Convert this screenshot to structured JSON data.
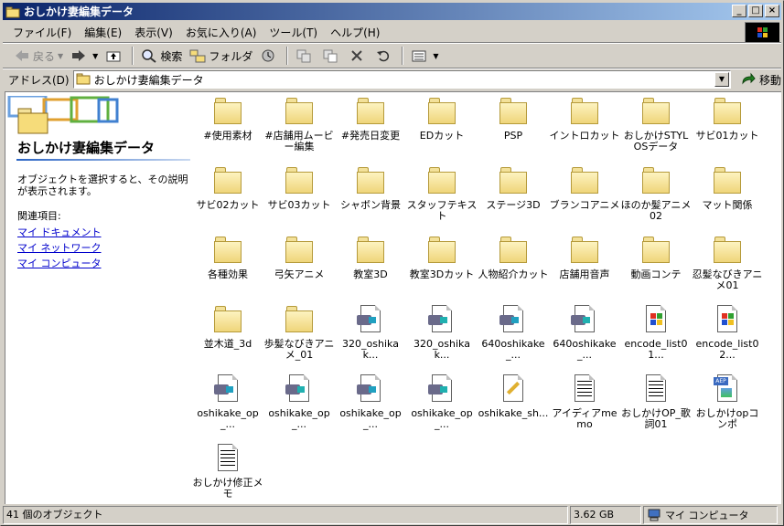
{
  "window": {
    "title": "おしかけ妻編集データ",
    "controls": {
      "minimize": "_",
      "maximize": "□",
      "close": "×"
    }
  },
  "menu": [
    "ファイル(F)",
    "編集(E)",
    "表示(V)",
    "お気に入り(A)",
    "ツール(T)",
    "ヘルプ(H)"
  ],
  "toolbar": {
    "back": "戻る",
    "search": "検索",
    "folders": "フォルダ"
  },
  "address": {
    "label": "アドレス(D)",
    "value": "おしかけ妻編集データ",
    "go": "移動"
  },
  "left_panel": {
    "title": "おしかけ妻編集データ",
    "description": "オブジェクトを選択すると、その説明が表示されます。",
    "related_heading": "関連項目:",
    "links": [
      "マイ ドキュメント",
      "マイ ネットワーク",
      "マイ コンピュータ"
    ]
  },
  "items": [
    {
      "label": "#使用素材",
      "type": "folder"
    },
    {
      "label": "#店舗用ムービー編集",
      "type": "folder"
    },
    {
      "label": "#発売日変更",
      "type": "folder"
    },
    {
      "label": "EDカット",
      "type": "folder"
    },
    {
      "label": "PSP",
      "type": "folder"
    },
    {
      "label": "イントロカット",
      "type": "folder"
    },
    {
      "label": "おしかけSTYLOSデータ",
      "type": "folder"
    },
    {
      "label": "サビ01カット",
      "type": "folder"
    },
    {
      "label": "サビ02カット",
      "type": "folder"
    },
    {
      "label": "サビ03カット",
      "type": "folder"
    },
    {
      "label": "シャボン背景",
      "type": "folder"
    },
    {
      "label": "スタッフテキスト",
      "type": "folder"
    },
    {
      "label": "ステージ3D",
      "type": "folder"
    },
    {
      "label": "ブランコアニメ",
      "type": "folder"
    },
    {
      "label": "ほのか髪アニメ02",
      "type": "folder"
    },
    {
      "label": "マット関係",
      "type": "folder"
    },
    {
      "label": "各種効果",
      "type": "folder"
    },
    {
      "label": "弓矢アニメ",
      "type": "folder"
    },
    {
      "label": "教室3D",
      "type": "folder"
    },
    {
      "label": "教室3Dカット",
      "type": "folder"
    },
    {
      "label": "人物紹介カット",
      "type": "folder"
    },
    {
      "label": "店舗用音声",
      "type": "folder"
    },
    {
      "label": "動画コンテ",
      "type": "folder"
    },
    {
      "label": "忍髪なびきアニメ01",
      "type": "folder"
    },
    {
      "label": "並木道_3d",
      "type": "folder"
    },
    {
      "label": "歩髪なびきアニメ_01",
      "type": "folder"
    },
    {
      "label": "320_oshikak...",
      "type": "video"
    },
    {
      "label": "320_oshikak...",
      "type": "video2"
    },
    {
      "label": "640oshikake_...",
      "type": "video"
    },
    {
      "label": "640oshikake_...",
      "type": "video2"
    },
    {
      "label": "encode_list01...",
      "type": "winfile"
    },
    {
      "label": "encode_list02...",
      "type": "winfile"
    },
    {
      "label": "oshikake_op_...",
      "type": "video"
    },
    {
      "label": "oshikake_op_...",
      "type": "video2"
    },
    {
      "label": "oshikake_op_...",
      "type": "video"
    },
    {
      "label": "oshikake_op_...",
      "type": "video2"
    },
    {
      "label": "oshikake_sh...",
      "type": "script"
    },
    {
      "label": "アイディアmemo",
      "type": "text"
    },
    {
      "label": "おしかけOP_歌詞01",
      "type": "text"
    },
    {
      "label": "おしかけopコンポ",
      "type": "aep"
    },
    {
      "label": "おしかけ修正メモ",
      "type": "text"
    }
  ],
  "status": {
    "count": "41 個のオブジェクト",
    "size": "3.62 GB",
    "location": "マイ コンピュータ"
  },
  "colors": {
    "title_start": "#0a246a",
    "title_end": "#a6caf0",
    "face": "#d4d0c8",
    "link": "#0000cc"
  }
}
